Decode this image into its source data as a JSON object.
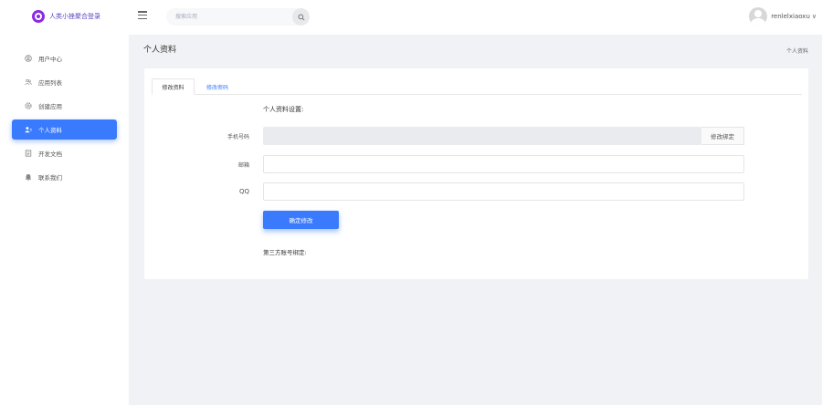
{
  "header": {
    "logo_text": "人类小挫聚合登录",
    "search_placeholder": "搜索应用",
    "username": "renlelxiaoxu",
    "caret": "∨"
  },
  "sidebar": {
    "items": [
      {
        "label": "用户中心",
        "icon": "user-circle-icon"
      },
      {
        "label": "应用列表",
        "icon": "users-icon"
      },
      {
        "label": "创建应用",
        "icon": "gear-icon"
      },
      {
        "label": "个人资料",
        "icon": "profile-icon",
        "active": true
      },
      {
        "label": "开发文档",
        "icon": "document-icon"
      },
      {
        "label": "联系我们",
        "icon": "bell-icon"
      }
    ]
  },
  "main": {
    "page_title": "个人资料",
    "breadcrumb": "个人资料",
    "tabs": [
      {
        "label": "修改资料",
        "active": true
      },
      {
        "label": "修改密码",
        "active": false
      }
    ],
    "section_heading": "个人资料设置:",
    "form": {
      "phone_label": "手机号码",
      "phone_value": "",
      "phone_action": "修改绑定",
      "email_label": "邮箱",
      "email_value": "",
      "qq_label": "QQ",
      "qq_value": "",
      "submit_label": "确定修改"
    },
    "third_party_heading": "第三方账号绑定:"
  },
  "colors": {
    "accent": "#3a7bfd",
    "logo": "#8a2be2",
    "background": "#f0f2f5"
  }
}
